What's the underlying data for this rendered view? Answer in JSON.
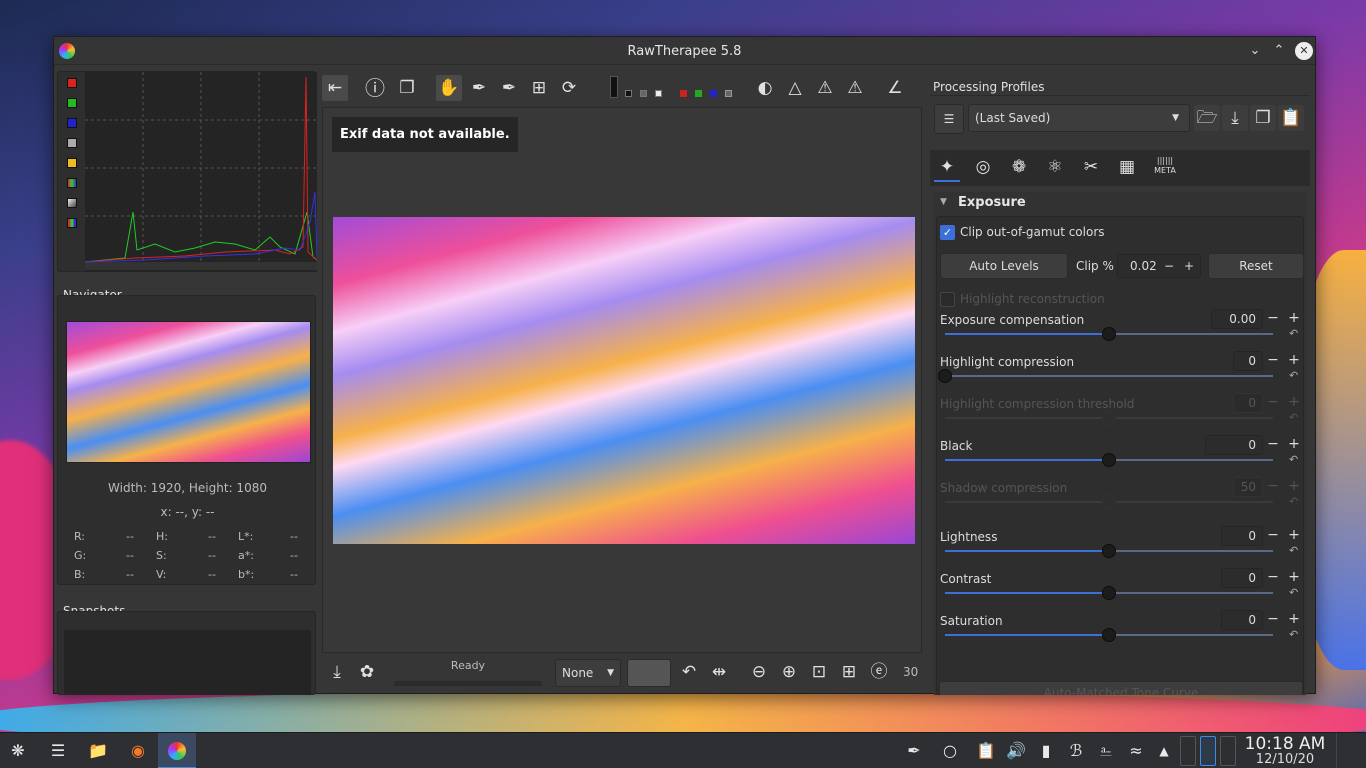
{
  "window": {
    "title": "RawTherapee 5.8"
  },
  "histogram": {
    "channels": [
      "red",
      "green",
      "blue",
      "luminance",
      "chroma",
      "raw",
      "bar",
      "mode"
    ]
  },
  "navigator": {
    "title": "Navigator",
    "dimensions": "Width: 1920, Height: 1080",
    "coords": "x: --, y: --",
    "values": [
      [
        "R:",
        "--",
        "H:",
        "--",
        "L*:",
        "--"
      ],
      [
        "G:",
        "--",
        "S:",
        "--",
        "a*:",
        "--"
      ],
      [
        "B:",
        "--",
        "V:",
        "--",
        "b*:",
        "--"
      ]
    ]
  },
  "snapshots": {
    "title": "Snapshots"
  },
  "editor": {
    "exif": "Exif data not available.",
    "status": "Ready",
    "color_mgmt": "None",
    "zoom": "30"
  },
  "profiles": {
    "title": "Processing Profiles",
    "selected": "(Last Saved)"
  },
  "tabs": [
    "Exposure",
    "Detail",
    "Color",
    "Advanced",
    "Transform",
    "Raw",
    "Metadata"
  ],
  "exposure": {
    "title": "Exposure",
    "clip_label": "Clip out-of-gamut colors",
    "auto_levels": "Auto Levels",
    "clip_pct_label": "Clip %",
    "clip_pct_value": "0.02",
    "reset": "Reset",
    "highlight_recon": "Highlight reconstruction",
    "sliders": [
      {
        "label": "Exposure compensation",
        "value": "0.00",
        "level": 0.5,
        "enabled": true
      },
      {
        "label": "Highlight compression",
        "value": "0",
        "level": 0.0,
        "enabled": true
      },
      {
        "label": "Highlight compression threshold",
        "value": "0",
        "level": 0.5,
        "enabled": false
      },
      {
        "label": "Black",
        "value": "0",
        "level": 0.5,
        "enabled": true
      },
      {
        "label": "Shadow compression",
        "value": "50",
        "level": 0.5,
        "enabled": false
      },
      {
        "label": "Lightness",
        "value": "0",
        "level": 0.5,
        "enabled": true
      },
      {
        "label": "Contrast",
        "value": "0",
        "level": 0.5,
        "enabled": true
      },
      {
        "label": "Saturation",
        "value": "0",
        "level": 0.5,
        "enabled": true
      }
    ],
    "tone_curve": "Auto-Matched Tone Curve"
  },
  "taskbar": {
    "time": "10:18 AM",
    "date": "12/10/20"
  },
  "colors": {
    "accent": "#3c70d8",
    "bg": "#363636",
    "panel": "#2e2e2e"
  }
}
